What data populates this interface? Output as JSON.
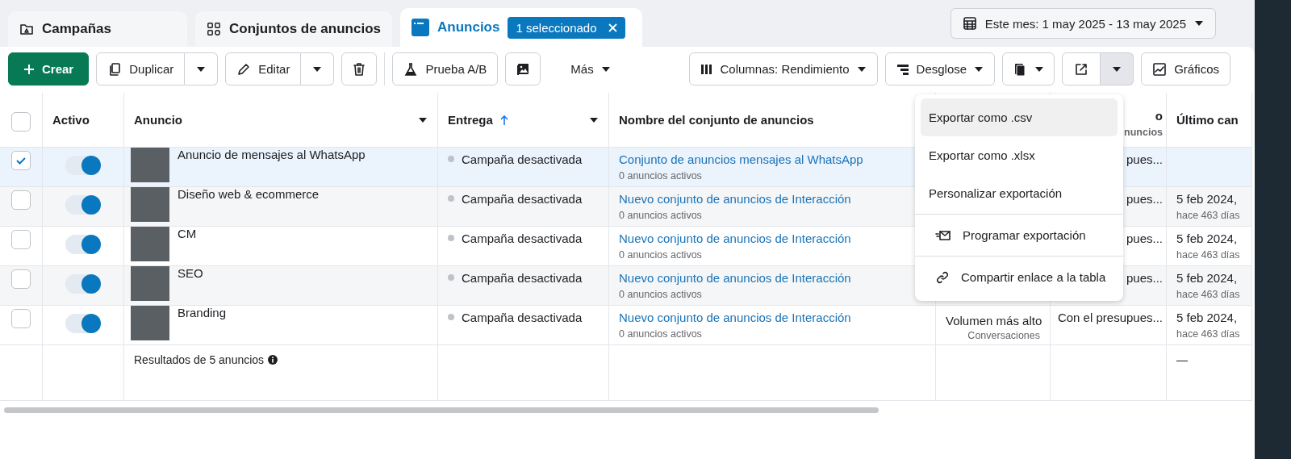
{
  "tabs": [
    {
      "label": "Campañas",
      "selected": false
    },
    {
      "label": "Conjuntos de anuncios",
      "selected": false
    },
    {
      "label": "Anuncios",
      "selected": true,
      "badge": "1 seleccionado"
    }
  ],
  "date_range": {
    "label": "Este mes: 1 may 2025 - 13 may 2025"
  },
  "toolbar": {
    "left": [
      {
        "kind": "primary",
        "label": "Crear"
      },
      {
        "kind": "split",
        "label": "Duplicar",
        "open": false
      },
      {
        "kind": "split",
        "label": "Editar",
        "open": false
      },
      {
        "kind": "icon"
      },
      {
        "kind": "separator"
      },
      {
        "kind": "button",
        "label": "Prueba A/B"
      },
      {
        "kind": "icon"
      },
      {
        "kind": "menu",
        "label": "Más"
      }
    ],
    "right": [
      {
        "kind": "menu",
        "label": "Columnas: Rendimiento"
      },
      {
        "kind": "menu",
        "label": "Desglose"
      },
      {
        "kind": "icon-menu"
      },
      {
        "kind": "split-icon",
        "open": true
      },
      {
        "kind": "button",
        "label": "Gráficos"
      }
    ]
  },
  "table": {
    "header_checked": false,
    "columns": [
      {
        "label": "Activo"
      },
      {
        "label": "Anuncio",
        "menu": true
      },
      {
        "label": "Entrega",
        "menu": true,
        "sorted": true
      },
      {
        "label": "Nombre del conjunto de anuncios"
      },
      {
        "label": "o",
        "sub": "nuncios"
      },
      {
        "label": "Último can"
      }
    ],
    "rows": [
      {
        "checked": true,
        "active": true,
        "name": "Anuncio de mensajes al WhatsApp",
        "delivery": "Campaña desactivada",
        "ad_set": "Conjunto de anuncios mensajes al WhatsApp",
        "ad_set_sub": "0 anuncios activos",
        "column_6": "pues..."
      },
      {
        "checked": false,
        "active": true,
        "name": "Diseño web & ecommerce",
        "delivery": "Campaña desactivada",
        "ad_set": "Nuevo conjunto de anuncios de Interacción",
        "ad_set_sub": "0 anuncios activos",
        "column_6": "pues...",
        "last_change": "5 feb 2024,",
        "last_change_sub": "hace 463 días"
      },
      {
        "checked": false,
        "active": true,
        "name": "CM",
        "delivery": "Campaña desactivada",
        "ad_set": "Nuevo conjunto de anuncios de Interacción",
        "ad_set_sub": "0 anuncios activos",
        "column_6": "pues...",
        "last_change": "5 feb 2024,",
        "last_change_sub": "hace 463 días"
      },
      {
        "checked": false,
        "active": true,
        "name": "SEO",
        "delivery": "Campaña desactivada",
        "ad_set": "Nuevo conjunto de anuncios de Interacción",
        "ad_set_sub": "0 anuncios activos",
        "column_6": "pues...",
        "last_change": "5 feb 2024,",
        "last_change_sub": "hace 463 días"
      },
      {
        "checked": false,
        "active": true,
        "name": "Branding",
        "delivery": "Campaña desactivada",
        "ad_set": "Nuevo conjunto de anuncios de Interacción",
        "ad_set_sub": "0 anuncios activos",
        "column_5": "Volumen más alto",
        "column_5_sub": "Conversaciones",
        "column_6": "Con el presupues...",
        "last_change": "5 feb 2024,",
        "last_change_sub": "hace 463 días"
      }
    ],
    "footer": {
      "label": "Resultados de 5 anuncios",
      "last_change": "—"
    }
  },
  "export_menu": [
    {
      "label": "Exportar como .csv",
      "highlighted": true,
      "divider_before": false
    },
    {
      "label": "Exportar como .xlsx",
      "highlighted": false,
      "divider_before": false
    },
    {
      "label": "Personalizar exportación",
      "highlighted": false,
      "divider_before": false
    },
    {
      "label": "Programar exportación",
      "highlighted": false,
      "divider_before": true
    },
    {
      "label": "Compartir enlace a la tabla",
      "highlighted": false,
      "divider_before": true
    }
  ]
}
